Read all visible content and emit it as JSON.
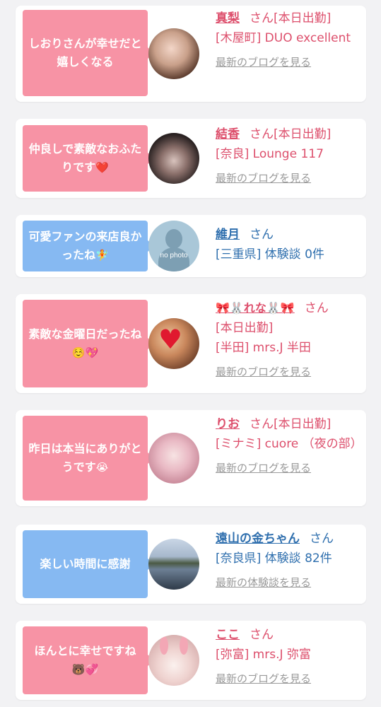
{
  "cards": [
    {
      "message": "しおりさんが幸せだと嬉しくなる",
      "name": "真梨",
      "honorific": "さん",
      "status": "[本日出勤]",
      "shop": "[木屋町] DUO excellent",
      "link": "最新のブログを見る"
    },
    {
      "message": "仲良しで素敵なおふたりです",
      "emoji": "❤️",
      "name": "結香",
      "honorific": "さん",
      "status": "[本日出勤]",
      "shop": "[奈良] Lounge 117",
      "link": "最新のブログを見る"
    },
    {
      "message": "可愛ファンの来店良かったね",
      "emoji": "🧚",
      "name": "維月",
      "honorific": "さん",
      "shop": "[三重県] 体験談 0件",
      "avatar_text": "no photo"
    },
    {
      "message": "素敵な金曜日だったね",
      "emoji": "☺️💖",
      "name": "🎀🐰れな🐰🎀",
      "honorific": "さん",
      "status": "[本日出勤]",
      "shop": "[半田] mrs.J 半田",
      "link": "最新のブログを見る"
    },
    {
      "message": "昨日は本当にありがとうです",
      "emoji": "😭",
      "name": "りお",
      "honorific": "さん",
      "status": "[本日出勤]",
      "shop": "[ミナミ] cuore （夜の部）",
      "link": "最新のブログを見る"
    },
    {
      "message": "楽しい時間に感謝",
      "name": "遠山の金ちゃん",
      "honorific": "さん",
      "shop": "[奈良県] 体験談 82件",
      "link": "最新の体験談を見る"
    },
    {
      "message": "ほんとに幸せですね",
      "emoji": "🐻💞",
      "name": "ここ",
      "honorific": "さん",
      "shop": "[弥富] mrs.J 弥富",
      "link": "最新のブログを見る"
    }
  ],
  "colors": {
    "pink_bubble": "#f793a5",
    "blue_bubble": "#86b9f2",
    "pink_text": "#dd4f6c",
    "blue_text": "#2f6fae"
  }
}
